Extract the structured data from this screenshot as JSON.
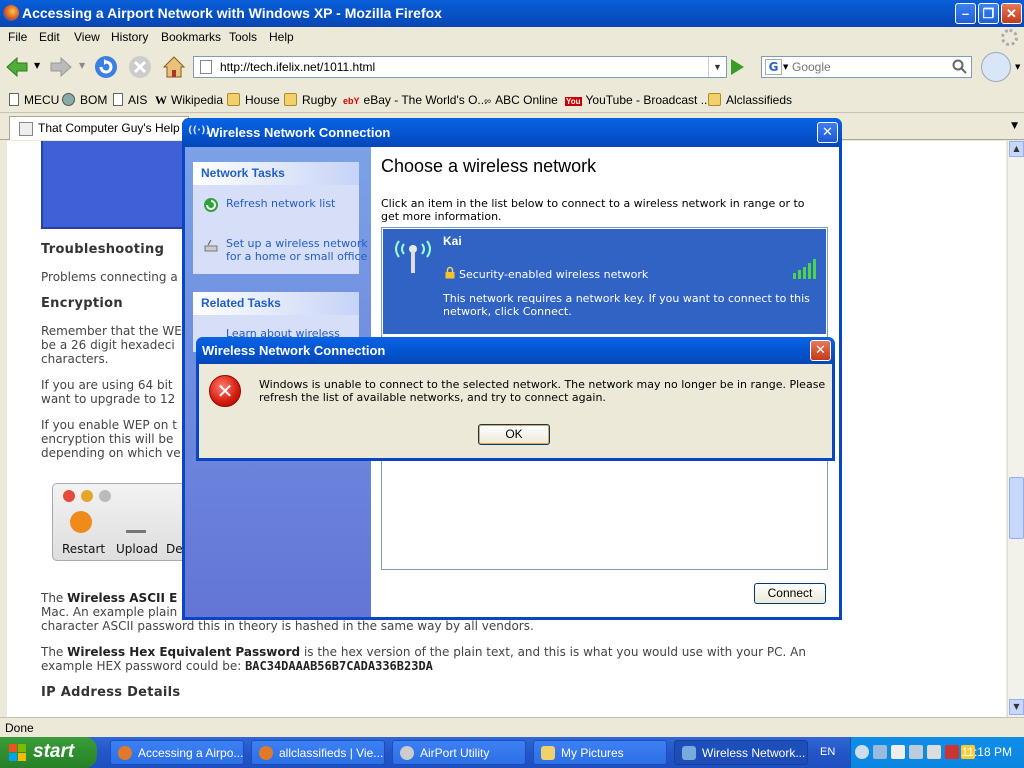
{
  "browser": {
    "window_title": "Accessing a Airport Network with Windows XP - Mozilla Firefox",
    "menu": [
      "File",
      "Edit",
      "View",
      "History",
      "Bookmarks",
      "Tools",
      "Help"
    ],
    "url": "http://tech.ifelix.net/1011.html",
    "search_placeholder": "Google",
    "bookmarks": [
      "MECU",
      "BOM",
      "AIS",
      "Wikipedia",
      "House",
      "Rugby",
      "eBay - The World's O...",
      "ABC Online",
      "YouTube - Broadcast ...",
      "Alclassifieds"
    ],
    "tab_label": "That Computer Guy's Help For",
    "status": "Done"
  },
  "page": {
    "troubleshooting_heading": "Troubleshooting",
    "troubleshooting_text": "Problems connecting a",
    "encryption_heading": "Encryption",
    "encryption_lines": [
      "Remember that the WE",
      "be a 26 digit hexadeci",
      "characters."
    ],
    "bit64_lines": [
      "If you are using 64 bit",
      "want to upgrade to 12"
    ],
    "wep_lines": [
      "If you enable WEP on t",
      "encryption this will be",
      "depending on which ve"
    ],
    "toolbar_labels": [
      "Restart",
      "Upload",
      "Defa"
    ],
    "ascii_line1_prefix": "The ",
    "ascii_bold": "Wireless ASCII E",
    "ascii_line2": "Mac. An example plain",
    "ascii_line3": "character ASCII password this in theory is hashed in the same way by all vendors.",
    "hex_prefix": "The ",
    "hex_bold": "Wireless Hex Equivalent Password",
    "hex_rest": " is the hex version of the plain text, and this is what you would use with your PC. An",
    "hex_line2": "example HEX password could be: ",
    "hex_example": "BAC34DAAAB56B7CADA336B23DA",
    "ip_heading": "IP Address Details"
  },
  "wireless_window": {
    "title": "Wireless Network Connection",
    "network_tasks_header": "Network Tasks",
    "refresh_label": "Refresh network list",
    "setup_label_1": "Set up a wireless network",
    "setup_label_2": "for a home or small office",
    "related_tasks_header": "Related Tasks",
    "related_item_partial": "Learn about wireless",
    "heading": "Choose a wireless network",
    "description": "Click an item in the list below to connect to a wireless network in range or to get more information.",
    "network": {
      "name": "Kai",
      "security": "Security-enabled wireless network",
      "message": "This network requires a network key. If you want to connect to this network, click Connect."
    },
    "signal_bars": 5,
    "connect_label": "Connect"
  },
  "error_dialog": {
    "title": "Wireless Network Connection",
    "message": "Windows is unable to connect to the selected network. The network may no longer be in range. Please refresh the list of available networks, and try to connect again.",
    "ok_label": "OK"
  },
  "taskbar": {
    "start_label": "start",
    "items": [
      "Accessing a Airpo...",
      "allclassifieds | Vie...",
      "AirPort Utility",
      "My Pictures",
      "Wireless Network..."
    ],
    "language": "EN",
    "clock": "11:18 PM"
  }
}
